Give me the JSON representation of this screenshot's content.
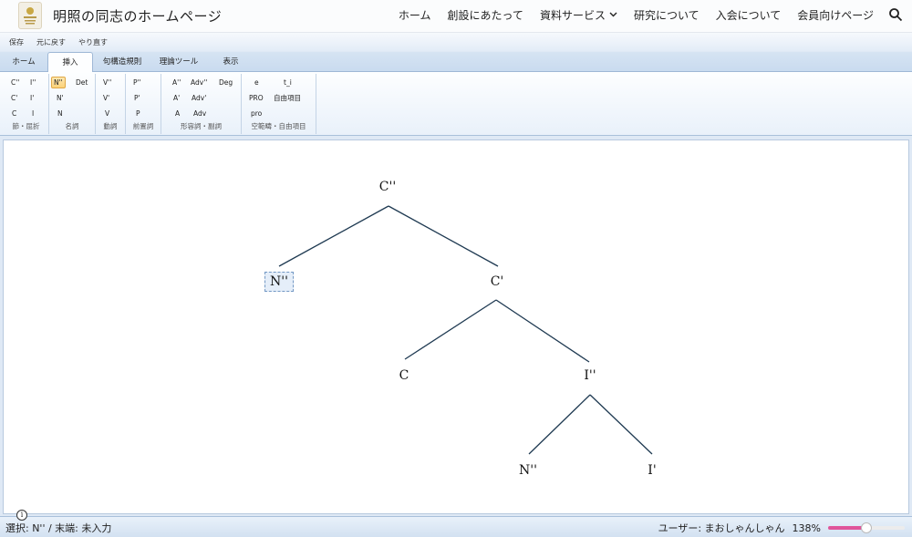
{
  "site": {
    "title": "明照の同志のホームページ",
    "nav": [
      "ホーム",
      "創設にあたって",
      "資料サービス",
      "研究について",
      "入会について",
      "会員向けページ"
    ]
  },
  "qat": [
    "保存",
    "元に戻す",
    "やり直す"
  ],
  "tabs": [
    "ホーム",
    "挿入",
    "句構造規則",
    "理論ツール",
    "表示"
  ],
  "active_tab": "挿入",
  "ribbon": {
    "clause": {
      "label": "節・屈折",
      "buttons": [
        "C''",
        "I''",
        "C'",
        "I'",
        "C",
        "I"
      ]
    },
    "noun": {
      "label": "名詞",
      "buttons": [
        "N''",
        "Det",
        "N'",
        "N"
      ]
    },
    "verb": {
      "label": "動詞",
      "buttons": [
        "V''",
        "V'",
        "V"
      ]
    },
    "prep": {
      "label": "前置詞",
      "buttons": [
        "P''",
        "P'",
        "P"
      ]
    },
    "adj": {
      "label": "形容詞・副詞",
      "buttons": [
        "A''",
        "Adv''",
        "Deg",
        "A'",
        "Adv'",
        "A",
        "Adv"
      ]
    },
    "empty": {
      "label": "空範疇・自由項目",
      "buttons": [
        "e",
        "t_i",
        "PRO",
        "自由項目",
        "pro"
      ]
    }
  },
  "tree": {
    "root": "C''",
    "spec_c": "N''",
    "c_bar": "C'",
    "c_head": "C",
    "ip": "I''",
    "spec_i": "N''",
    "i_bar": "I'"
  },
  "status": {
    "selection": "選択: N'' / 末端: 未入力",
    "user": "ユーザー: まおしゃんしゃん",
    "zoom": "138%",
    "zoom_fraction": 0.5
  },
  "colors": {
    "accent": "#e0559a",
    "tree_line": "#1f3a52"
  }
}
